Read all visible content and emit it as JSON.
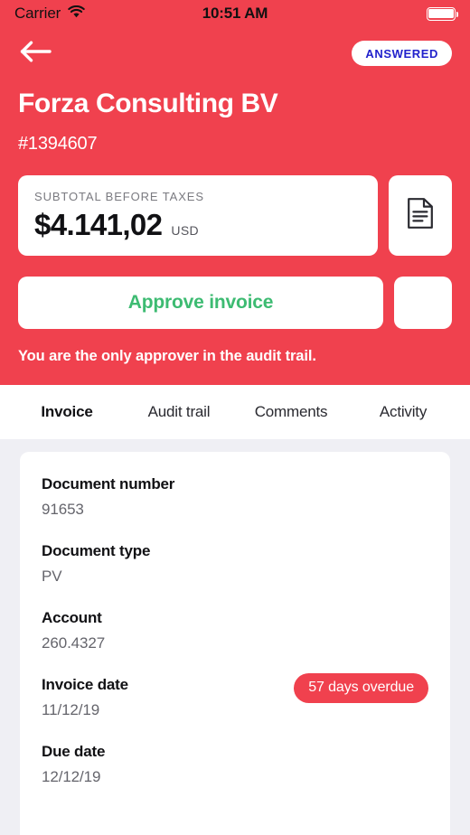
{
  "status_bar": {
    "carrier": "Carrier",
    "wifi_icon": "wifi-icon",
    "time": "10:51 AM",
    "battery_icon": "battery-full-icon"
  },
  "header": {
    "background_color": "#F0414E",
    "back_icon": "arrow-left-icon",
    "status_badge": {
      "label": "ANSWERED",
      "text_color": "#2222CC",
      "background_color": "#FFFFFF"
    },
    "vendor_name": "Forza Consulting BV",
    "invoice_reference": "#1394607",
    "amount_card": {
      "label": "SUBTOTAL BEFORE TAXES",
      "value": "$4.141,02",
      "currency": "USD"
    },
    "document_icon": "document-icon",
    "approve_button": {
      "label": "Approve invoice",
      "text_color": "#3DBB72"
    },
    "overflow_icon": "more-vertical-icon",
    "approver_note": "You are the only approver in the audit trail."
  },
  "tabs": [
    {
      "label": "Invoice",
      "active": true
    },
    {
      "label": "Audit trail",
      "active": false
    },
    {
      "label": "Comments",
      "active": false
    },
    {
      "label": "Activity",
      "active": false
    }
  ],
  "invoice_details": {
    "fields": [
      {
        "label": "Document number",
        "value": "91653"
      },
      {
        "label": "Document type",
        "value": "PV"
      },
      {
        "label": "Account",
        "value": "260.4327"
      },
      {
        "label": "Invoice date",
        "value": "11/12/19",
        "badge": "57 days overdue"
      },
      {
        "label": "Due date",
        "value": "12/12/19"
      }
    ],
    "overdue_badge_color": "#F0414E"
  }
}
